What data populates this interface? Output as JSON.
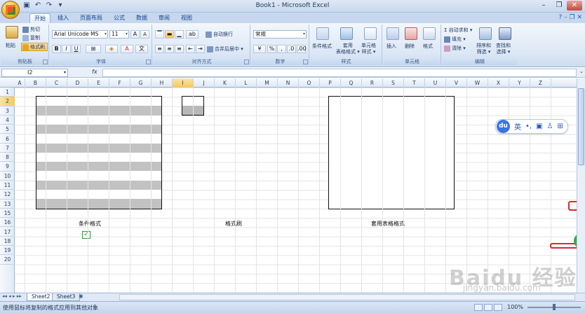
{
  "window": {
    "title": "Book1 - Microsoft Excel"
  },
  "tabs": [
    "开始",
    "插入",
    "页面布局",
    "公式",
    "数据",
    "审阅",
    "视图"
  ],
  "ribbon": {
    "clipboard": {
      "paste": "粘贴",
      "cut": "剪切",
      "copy": "复制",
      "format_painter": "格式刷",
      "label": "剪贴板"
    },
    "font": {
      "name": "Arial Unicode MS",
      "size": "11",
      "label": "字体"
    },
    "alignment": {
      "wrap": "自动换行",
      "merge": "合并后居中",
      "label": "对齐方式"
    },
    "number": {
      "format": "常规",
      "label": "数字"
    },
    "styles": {
      "conditional": "条件格式",
      "table": "套用\n表格格式",
      "cell": "单元格\n样式",
      "label": "样式"
    },
    "cells": {
      "insert": "插入",
      "delete": "删除",
      "format": "格式",
      "label": "单元格"
    },
    "editing": {
      "autosum": "自动求和",
      "fill": "填充",
      "clear": "清除",
      "sort": "排序和\n筛选",
      "find": "查找和\n选择",
      "label": "编辑"
    }
  },
  "formula_bar": {
    "name_box": "I2",
    "fx": "fx"
  },
  "columns": [
    "A",
    "B",
    "C",
    "D",
    "E",
    "F",
    "G",
    "H",
    "I",
    "J",
    "K",
    "L",
    "M",
    "N",
    "O",
    "P",
    "Q",
    "R",
    "S",
    "T",
    "U",
    "V",
    "W",
    "X",
    "Y",
    "Z"
  ],
  "rows": [
    "1",
    "2",
    "3",
    "4",
    "5",
    "6",
    "7",
    "8",
    "9",
    "10",
    "11",
    "12",
    "13",
    "15",
    "16",
    "17",
    "18",
    "19",
    "20"
  ],
  "selected": {
    "column": "I",
    "row": "2"
  },
  "captions": {
    "conditional": "条件格式",
    "painter": "格式刷",
    "table": "套用表格格式"
  },
  "sheets": [
    "Sheet2",
    "Sheet3"
  ],
  "status": {
    "text": "使用鼠标将复制的格式应用到其他对象",
    "zoom": "100%"
  },
  "ime": {
    "logo": "du",
    "lang": "英"
  },
  "watermark": {
    "main": "Baidu 经验",
    "sub": "jingyan.baidu.com"
  }
}
